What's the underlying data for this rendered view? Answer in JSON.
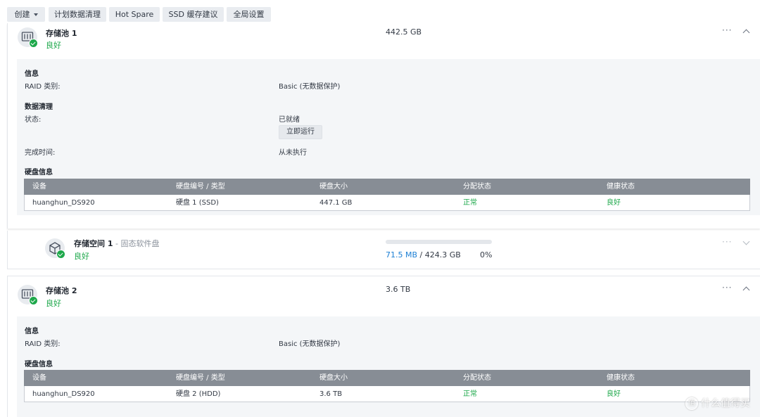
{
  "toolbar": {
    "create": "创建",
    "schedule_scrub": "计划数据清理",
    "hot_spare": "Hot Spare",
    "ssd_cache": "SSD 缓存建议",
    "global_settings": "全局设置"
  },
  "pool1": {
    "title": "存储池 1",
    "status": "良好",
    "size": "442.5 GB",
    "info_header": "信息",
    "raid_label": "RAID 类别:",
    "raid_value": "Basic (无数据保护)",
    "scrub_header": "数据清理",
    "scrub_status_label": "状态:",
    "scrub_status_value": "已就绪",
    "run_now": "立即运行",
    "complete_label": "完成时间:",
    "complete_value": "从未执行",
    "disk_header": "硬盘信息",
    "columns": [
      "设备",
      "硬盘编号 / 类型",
      "硬盘大小",
      "分配状态",
      "健康状态"
    ],
    "rows": [
      [
        "huanghun_DS920",
        "硬盘 1 (SSD)",
        "447.1 GB",
        "正常",
        "良好"
      ]
    ]
  },
  "volume1": {
    "title": "存储空间 1",
    "separator": " - ",
    "subtitle": "固态软件盘",
    "status": "良好",
    "used": "71.5 MB",
    "slash": " / ",
    "total": "424.3 GB",
    "percent": "0%",
    "usage_fraction": 0.0
  },
  "pool2": {
    "title": "存储池 2",
    "status": "良好",
    "size": "3.6 TB",
    "info_header": "信息",
    "raid_label": "RAID 类别:",
    "raid_value": "Basic (无数据保护)",
    "disk_header": "硬盘信息",
    "columns": [
      "设备",
      "硬盘编号 / 类型",
      "硬盘大小",
      "分配状态",
      "健康状态"
    ],
    "rows": [
      [
        "huanghun_DS920",
        "硬盘 2 (HDD)",
        "3.6 TB",
        "正常",
        "良好"
      ]
    ]
  },
  "icons": {
    "more": "···",
    "watermark_glyph": "值"
  },
  "watermark": "什么值得买",
  "colors": {
    "good": "#1ea84b",
    "link": "#1b7fd4",
    "table_header": "#878d95",
    "detail_bg": "#f4f6f8"
  }
}
